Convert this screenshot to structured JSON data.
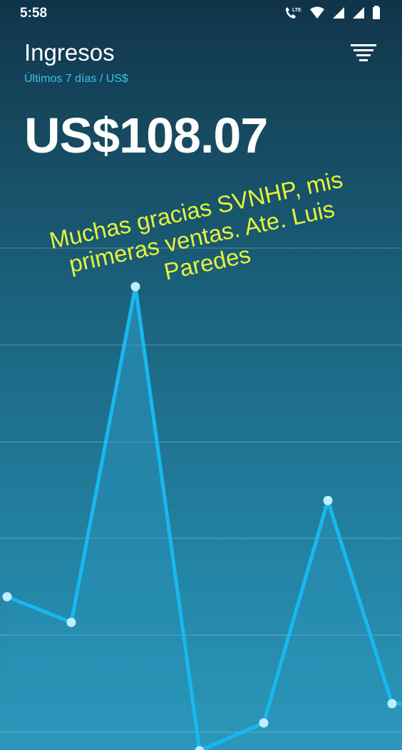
{
  "status_bar": {
    "time": "5:58",
    "network_label": "LTE",
    "icons": [
      "phone-lte-icon",
      "wifi-icon",
      "signal-icon",
      "signal-icon",
      "battery-icon"
    ]
  },
  "header": {
    "title": "Ingresos",
    "subtitle": "Últimos 7 días / US$",
    "filter_icon": "filter-icon"
  },
  "summary": {
    "total": "US$108.07"
  },
  "chart_data": {
    "type": "line",
    "series": [
      {
        "values": [
          3.5,
          2.3,
          18.0,
          -3.7,
          -2.4,
          8.0,
          -1.5
        ]
      }
    ],
    "grid": true,
    "line_color": "#18b8ef",
    "point_color": "#bfeefe"
  },
  "overlay": {
    "lines": [
      "Muchas gracias SVNHP, mis",
      "primeras ventas. Ate. Luis",
      "Paredes"
    ],
    "color": "#e6f23a"
  }
}
